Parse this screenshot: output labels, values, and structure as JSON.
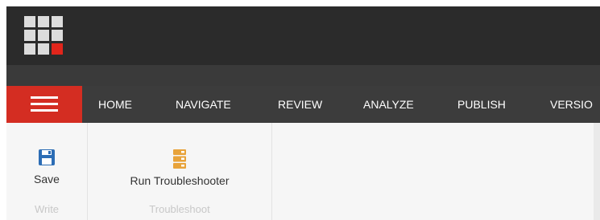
{
  "colors": {
    "topbar": "#2b2b2b",
    "tabstrip": "#3c3c3c",
    "menu_accent": "#d42d22",
    "logo_cell": "#dcdcdc",
    "logo_accent": "#e1251b",
    "save_icon": "#2c6db5",
    "troubleshoot_icon": "#e8a33a"
  },
  "header": {
    "logo_icon": "app-grid-logo-icon",
    "menu_icon": "hamburger-menu-icon"
  },
  "tabs": [
    {
      "label": "HOME"
    },
    {
      "label": "NAVIGATE"
    },
    {
      "label": "REVIEW"
    },
    {
      "label": "ANALYZE"
    },
    {
      "label": "PUBLISH"
    },
    {
      "label": "VERSIO"
    }
  ],
  "ribbon": {
    "groups": [
      {
        "label": "Write",
        "buttons": [
          {
            "label": "Save",
            "icon": "floppy-disk-icon"
          }
        ]
      },
      {
        "label": "Troubleshoot",
        "buttons": [
          {
            "label": "Run Troubleshooter",
            "icon": "troubleshooter-stack-icon"
          }
        ]
      }
    ]
  }
}
